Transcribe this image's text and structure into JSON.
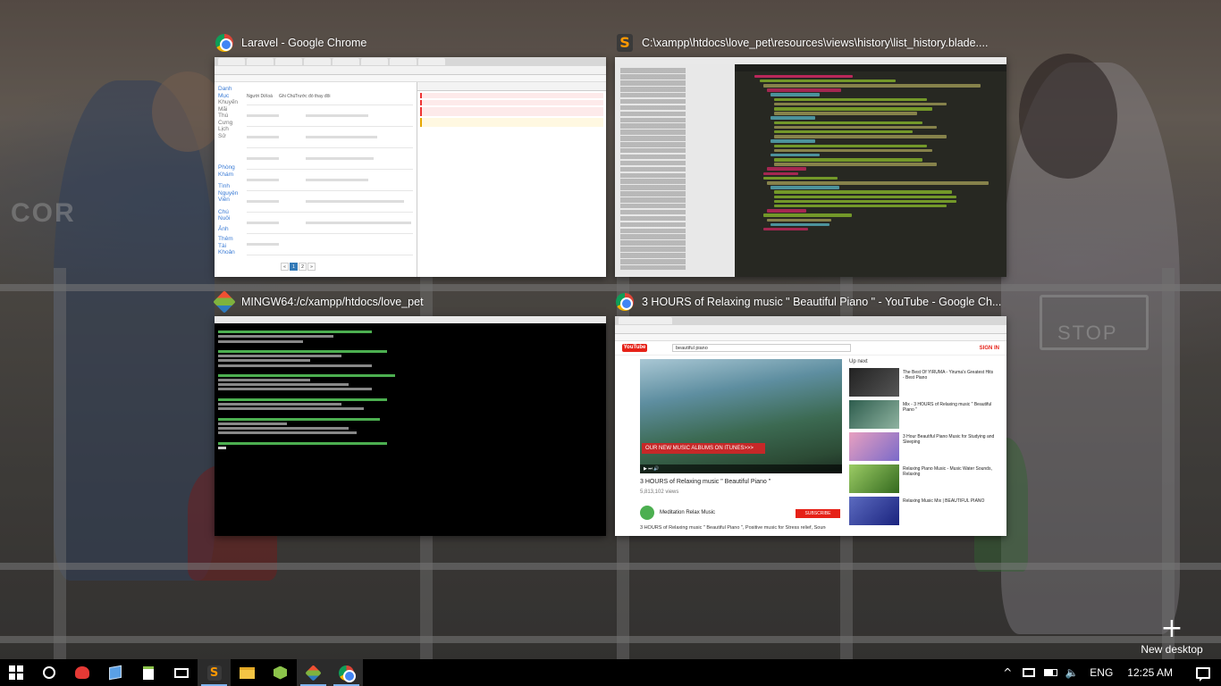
{
  "task_view": {
    "windows": [
      {
        "app": "chrome",
        "icon": "chrome-icon",
        "title": "Laravel - Google Chrome"
      },
      {
        "app": "sublime",
        "icon": "sublime-text-icon",
        "title": "C:\\xampp\\htdocs\\love_pet\\resources\\views\\history\\list_history.blade...."
      },
      {
        "app": "git-bash",
        "icon": "git-bash-icon",
        "title": "MINGW64:/c/xampp/htdocs/love_pet"
      },
      {
        "app": "chrome",
        "icon": "chrome-icon",
        "title": "3 HOURS of Relaxing music \" Beautiful Piano \" - YouTube - Google Ch..."
      }
    ],
    "new_desktop_label": "New desktop"
  },
  "thumb_laravel": {
    "sidebar": [
      "Danh Mục",
      "Khuyến Mãi",
      "Thú Cưng",
      "Lịch Sử",
      "Phòng Khám",
      "Tình Nguyện Viên",
      "Chú Nuôi",
      "Ảnh",
      "Thêm Tài Khoản"
    ],
    "headers": [
      "Người Dùng",
      "Xoá",
      "Ghi Chú",
      "Trước đó thay đổi"
    ],
    "pages": [
      "«",
      "1",
      "2",
      "»"
    ]
  },
  "thumb_youtube": {
    "logo": "YouTube",
    "search": "beautiful piano",
    "signin": "SIGN IN",
    "banner": "OUR NEW MUSIC ALBUMS ON ITUNES>>>",
    "video_title": "3 HOURS of Relaxing music \" Beautiful Piano \"",
    "views": "5,813,102 views",
    "channel": "Meditation Relax Music",
    "subscribe": "SUBSCRIBE",
    "description": "3 HOURS of Relaxing music \" Beautiful Piano \", Positive music for Stress relief, Sound",
    "up_next_label": "Up next",
    "up_next": [
      {
        "title": "The Best Of YIRUMA - Yiruma's Greatest Hits - Best Piano"
      },
      {
        "title": "Mix - 3 HOURS of Relaxing music \" Beautiful Piano \""
      },
      {
        "title": "3 Hour Beautiful Piano Music for Studying and Sleeping"
      },
      {
        "title": "Relaxing Piano Music - Music Water Sounds, Relaxing"
      },
      {
        "title": "Relaxing Music Mix | BEAUTIFUL PIANO"
      }
    ]
  },
  "taskbar": {
    "apps": [
      {
        "name": "snipping-tool",
        "icon": "scissors-icon"
      },
      {
        "name": "virtualbox",
        "icon": "box-icon"
      },
      {
        "name": "notepad-plus",
        "icon": "notepad-icon"
      },
      {
        "name": "mail",
        "icon": "mail-icon"
      },
      {
        "name": "sublime-text",
        "icon": "sublime-text-icon"
      },
      {
        "name": "file-explorer",
        "icon": "folder-icon"
      },
      {
        "name": "xampp",
        "icon": "hexagon-icon"
      },
      {
        "name": "git-bash",
        "icon": "git-bash-icon"
      },
      {
        "name": "chrome",
        "icon": "chrome-icon"
      }
    ],
    "language": "ENG",
    "clock": "12:25 AM"
  }
}
